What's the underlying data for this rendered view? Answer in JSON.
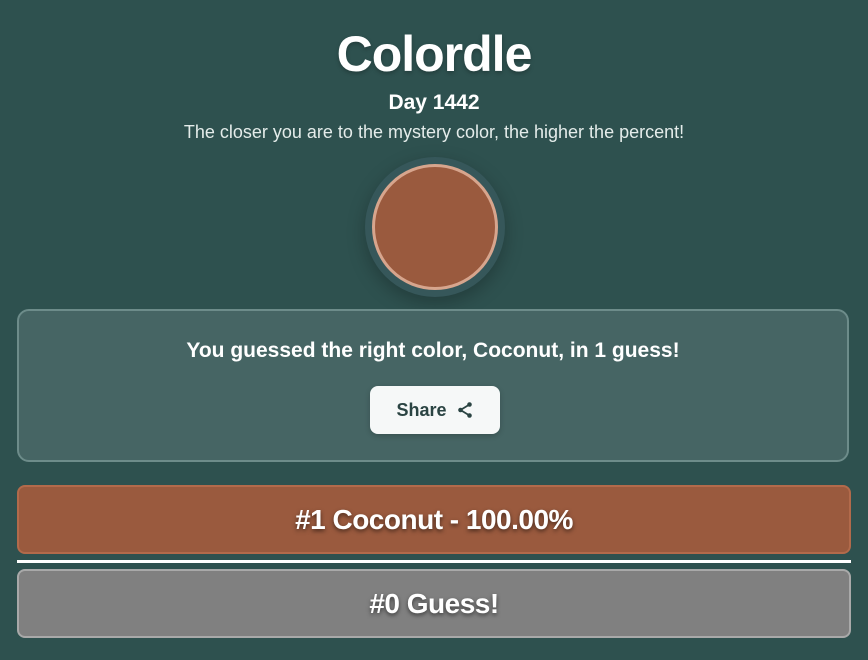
{
  "header": {
    "title": "Colordle",
    "day": "Day 1442",
    "subtitle": "The closer you are to the mystery color, the higher the percent!"
  },
  "mystery_color": "#9a5a3e",
  "result": {
    "message": "You guessed the right color, Coconut, in 1 guess!",
    "share_label": "Share",
    "share_icon": "share-icon"
  },
  "guesses": [
    {
      "label": "#1 Coconut - 100.00%",
      "color": "#9a5a3e",
      "percent": 100.0
    }
  ],
  "current_guess": {
    "label": "#0 Guess!",
    "color": "#808080"
  },
  "colors": {
    "background": "#2e514f",
    "panel": "#466564",
    "share_button": "#f6f8f8"
  }
}
